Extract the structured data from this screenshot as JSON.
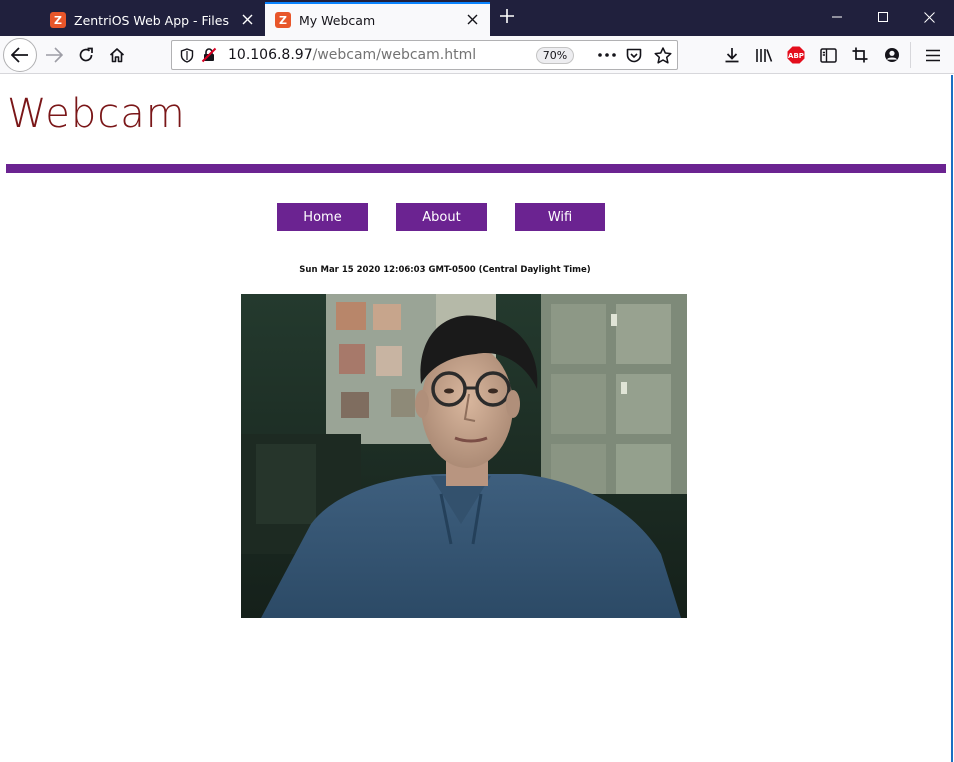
{
  "browser": {
    "tabs": [
      {
        "title": "ZentriOS Web App - Files",
        "favicon": "Z",
        "active": false
      },
      {
        "title": "My Webcam",
        "favicon": "Z",
        "active": true
      }
    ],
    "url": {
      "host": "10.106.8.97",
      "path": "/webcam/webcam.html"
    },
    "zoom": "70%",
    "accent_color": "#0a84ff"
  },
  "page": {
    "title": "Webcam",
    "nav": {
      "home": "Home",
      "about": "About",
      "wifi": "Wifi"
    },
    "timestamp": "Sun Mar 15 2020 12:06:03 GMT-0500 (Central Daylight Time)",
    "colors": {
      "title": "#7a1618",
      "accent": "#6b2391"
    }
  }
}
